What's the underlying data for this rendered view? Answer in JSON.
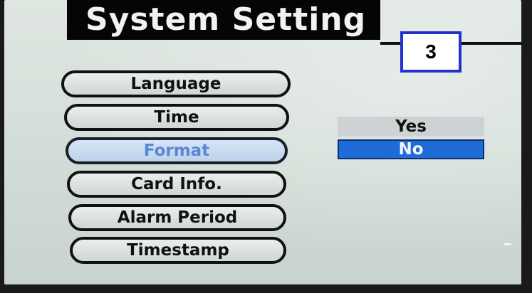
{
  "screen": {
    "title": "System Setting",
    "step_label": "3"
  },
  "menu": {
    "items": [
      {
        "label": "Language"
      },
      {
        "label": "Time"
      },
      {
        "label": "Format"
      },
      {
        "label": "Card Info."
      },
      {
        "label": "Alarm Period"
      },
      {
        "label": "Timestamp"
      }
    ],
    "selected": "Format"
  },
  "options": {
    "yes_label": "Yes",
    "no_label": "No",
    "selected": "No"
  },
  "colors": {
    "selection_blue": "#1f6bd8",
    "badge_border": "#2233cc"
  }
}
